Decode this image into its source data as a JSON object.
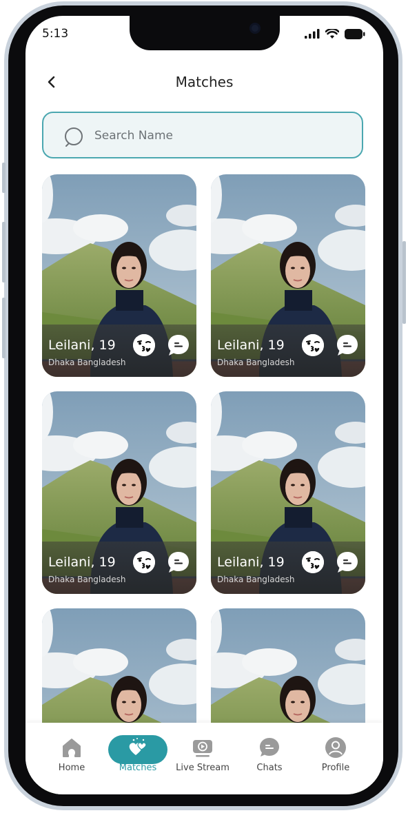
{
  "status_bar": {
    "time": "5:13"
  },
  "header": {
    "title": "Matches"
  },
  "search": {
    "placeholder": "Search Name"
  },
  "matches": [
    {
      "name_age": "Leilani, 19",
      "location": "Dhaka Bangladesh"
    },
    {
      "name_age": "Leilani, 19",
      "location": "Dhaka Bangladesh"
    },
    {
      "name_age": "Leilani, 19",
      "location": "Dhaka Bangladesh"
    },
    {
      "name_age": "Leilani, 19",
      "location": "Dhaka Bangladesh"
    },
    {
      "name_age": "",
      "location": ""
    },
    {
      "name_age": "",
      "location": ""
    }
  ],
  "bottom_nav": {
    "items": [
      {
        "label": "Home",
        "icon": "home-icon"
      },
      {
        "label": "Matches",
        "icon": "hearts-icon",
        "active": true
      },
      {
        "label": "Live Stream",
        "icon": "live-stream-icon"
      },
      {
        "label": "Chats",
        "icon": "chat-bubble-icon"
      },
      {
        "label": "Profile",
        "icon": "profile-icon"
      }
    ]
  },
  "colors": {
    "accent": "#2a9aa4",
    "search_border": "#4aa7b0",
    "search_bg": "#eef5f6",
    "nav_icon": "#9a9a9a"
  }
}
